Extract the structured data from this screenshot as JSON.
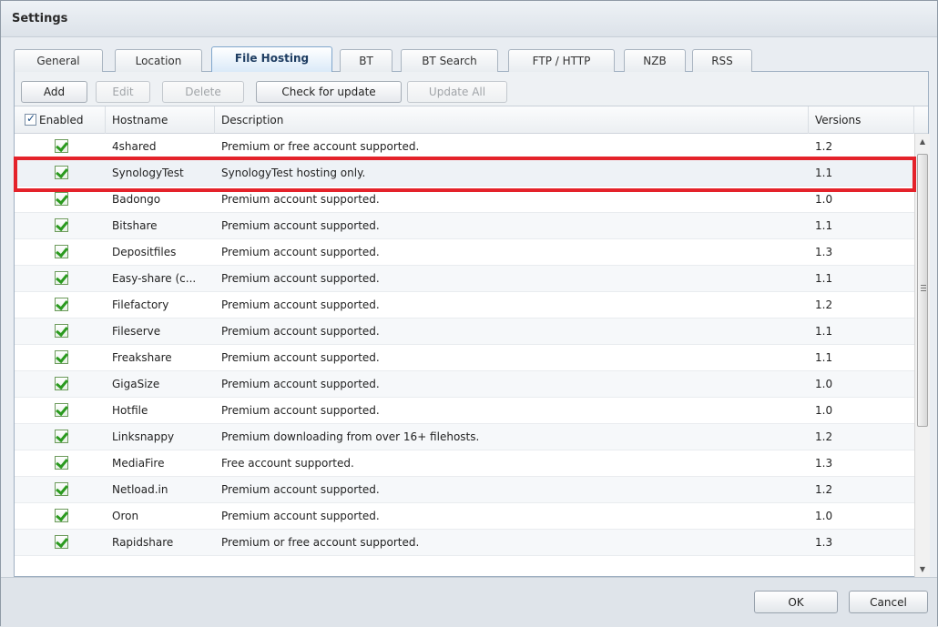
{
  "window": {
    "title": "Settings"
  },
  "tabs": [
    {
      "label": "General",
      "active": false
    },
    {
      "label": "Location",
      "active": false
    },
    {
      "label": "File Hosting",
      "active": true
    },
    {
      "label": "BT",
      "active": false
    },
    {
      "label": "BT Search",
      "active": false
    },
    {
      "label": "FTP / HTTP",
      "active": false
    },
    {
      "label": "NZB",
      "active": false
    },
    {
      "label": "RSS",
      "active": false
    }
  ],
  "toolbar": {
    "add": "Add",
    "edit": "Edit",
    "delete": "Delete",
    "check_update": "Check for update",
    "update_all": "Update All"
  },
  "columns": {
    "enabled": "Enabled",
    "hostname": "Hostname",
    "description": "Description",
    "versions": "Versions"
  },
  "rows": [
    {
      "enabled": true,
      "hostname": "4shared",
      "description": "Premium or free account supported.",
      "version": "1.2"
    },
    {
      "enabled": true,
      "hostname": "SynologyTest",
      "description": "SynologyTest hosting only.",
      "version": "1.1"
    },
    {
      "enabled": true,
      "hostname": "Badongo",
      "description": "Premium account supported.",
      "version": "1.0"
    },
    {
      "enabled": true,
      "hostname": "Bitshare",
      "description": "Premium account supported.",
      "version": "1.1"
    },
    {
      "enabled": true,
      "hostname": "Depositfiles",
      "description": "Premium account supported.",
      "version": "1.3"
    },
    {
      "enabled": true,
      "hostname": "Easy-share (c...",
      "description": "Premium account supported.",
      "version": "1.1"
    },
    {
      "enabled": true,
      "hostname": "Filefactory",
      "description": "Premium account supported.",
      "version": "1.2"
    },
    {
      "enabled": true,
      "hostname": "Fileserve",
      "description": "Premium account supported.",
      "version": "1.1"
    },
    {
      "enabled": true,
      "hostname": "Freakshare",
      "description": "Premium account supported.",
      "version": "1.1"
    },
    {
      "enabled": true,
      "hostname": "GigaSize",
      "description": "Premium account supported.",
      "version": "1.0"
    },
    {
      "enabled": true,
      "hostname": "Hotfile",
      "description": "Premium account supported.",
      "version": "1.0"
    },
    {
      "enabled": true,
      "hostname": "Linksnappy",
      "description": "Premium downloading from over 16+ filehosts.",
      "version": "1.2"
    },
    {
      "enabled": true,
      "hostname": "MediaFire",
      "description": "Free account supported.",
      "version": "1.3"
    },
    {
      "enabled": true,
      "hostname": "Netload.in",
      "description": "Premium account supported.",
      "version": "1.2"
    },
    {
      "enabled": true,
      "hostname": "Oron",
      "description": "Premium account supported.",
      "version": "1.0"
    },
    {
      "enabled": true,
      "hostname": "Rapidshare",
      "description": "Premium or free account supported.",
      "version": "1.3"
    }
  ],
  "footer": {
    "ok": "OK",
    "cancel": "Cancel"
  },
  "colors": {
    "highlight": "#e4222a",
    "check": "#2a9a1e",
    "active_tab": "#d9e9f8"
  }
}
